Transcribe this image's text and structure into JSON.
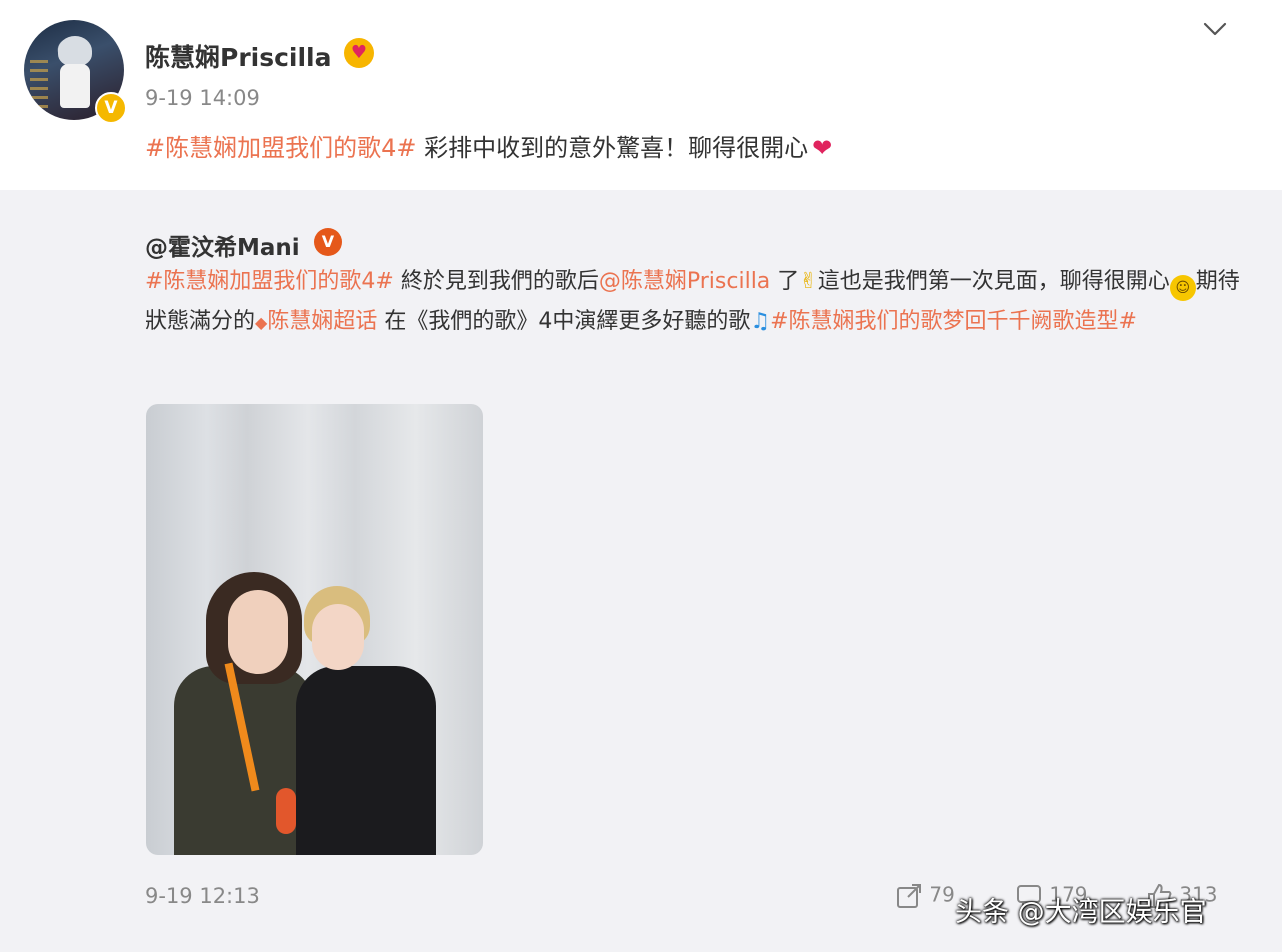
{
  "post": {
    "username": "陈慧娴Priscilla",
    "name_emoji": "heart-eyes-emoji",
    "verified_badge": "V",
    "time": "9-19 14:09",
    "topic": "#陈慧娴加盟我们的歌4#",
    "text": " 彩排中收到的意外驚喜！聊得很開心",
    "end_emoji": "❤"
  },
  "repost": {
    "username": "@霍汶希Mani",
    "verified_badge": "V",
    "topic1": "#陈慧娴加盟我们的歌4#",
    "text1": " 終於見到我們的歌后",
    "mention": "@陈慧娴Priscilla",
    "text2": " 了",
    "hand_emoji": "✌",
    "text3": "這也是我們第一次見面，聊得很開心",
    "face_emoji": "☺",
    "text4": "期待狀態滿分的",
    "super_topic_icon": "◆",
    "super_topic": "陈慧娴超话",
    "text5": " 在《我們的歌》4中演繹更多好聽的歌",
    "note_emoji": "♫",
    "topic2": "#陈慧娴我们的歌梦回千千阙歌造型#",
    "time": "9-19 12:13",
    "actions": {
      "share_count": "79",
      "comment_count": "179",
      "like_count": "313"
    }
  },
  "watermark": "头条 @大湾区娱乐官",
  "icons": {
    "more": "chevron-down-icon",
    "share": "share-icon",
    "comment": "comment-icon",
    "like": "like-icon"
  },
  "colors": {
    "topic": "#eb7350",
    "verified_gold": "#f5b800",
    "verified_orange": "#e5581a",
    "repost_bg": "#f2f2f5"
  }
}
